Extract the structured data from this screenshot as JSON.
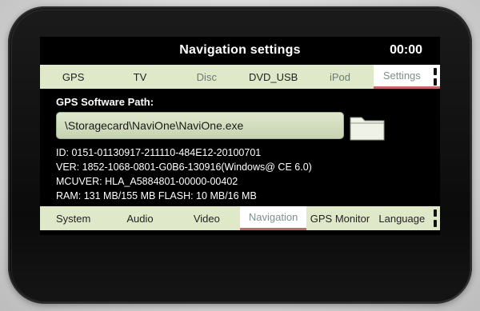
{
  "header": {
    "title": "Navigation settings",
    "time": "00:00"
  },
  "top_tabs": [
    {
      "label": "GPS"
    },
    {
      "label": "TV"
    },
    {
      "label": "Disc"
    },
    {
      "label": "DVD_USB"
    },
    {
      "label": "iPod"
    },
    {
      "label": "Settings"
    }
  ],
  "gps": {
    "path_label": "GPS Software Path:",
    "path_value": "\\Storagecard\\NaviOne\\NaviOne.exe",
    "id": "ID: 0151-01130917-211110-484E12-20100701",
    "ver": "VER: 1852-1068-0801-G0B6-130916(Windows@ CE 6.0)",
    "mcuver": "MCUVER: HLA_A5884801-00000-00402",
    "ram": "RAM: 131 MB/155 MB  FLASH: 10 MB/16 MB"
  },
  "bottom_tabs": [
    {
      "label": "System"
    },
    {
      "label": "Audio"
    },
    {
      "label": "Video"
    },
    {
      "label": "Navigation"
    },
    {
      "label": "GPS Monitor"
    },
    {
      "label": "Language"
    }
  ],
  "icons": {
    "folder": "folder-icon",
    "scroll": "scroll-indicator-icon"
  },
  "colors": {
    "tab_bg": "#dfe9c9",
    "active_tab_bg": "#ffffff",
    "active_underline": "#c66868"
  }
}
